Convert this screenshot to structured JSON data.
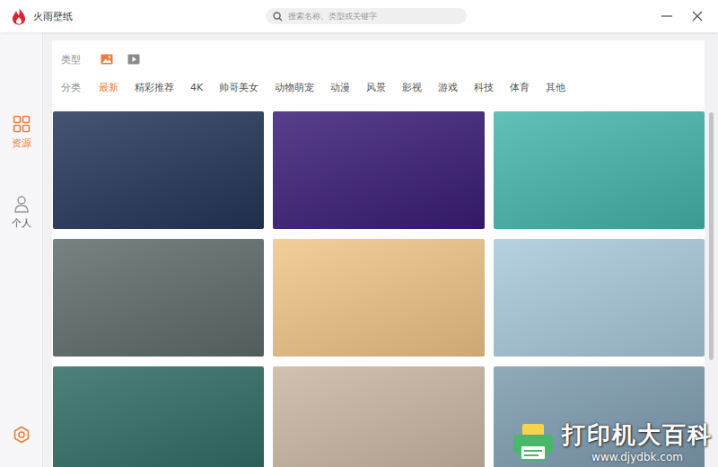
{
  "window": {
    "title": "火雨壁纸"
  },
  "search": {
    "placeholder": "搜索名称、类型或关键字"
  },
  "sidebar": {
    "items": [
      {
        "label": "资源",
        "kind": "grid",
        "selected": true
      },
      {
        "label": "个人",
        "kind": "user",
        "selected": false
      }
    ]
  },
  "filters": {
    "type_label": "类型",
    "types": [
      {
        "kind": "image",
        "selected": true
      },
      {
        "kind": "video",
        "selected": false
      }
    ],
    "category_label": "分类",
    "categories": [
      {
        "label": "最新",
        "selected": true
      },
      {
        "label": "精彩推荐",
        "selected": false
      },
      {
        "label": "4K",
        "selected": false
      },
      {
        "label": "帅哥美女",
        "selected": false
      },
      {
        "label": "动物萌宠",
        "selected": false
      },
      {
        "label": "动漫",
        "selected": false
      },
      {
        "label": "风景",
        "selected": false
      },
      {
        "label": "影视",
        "selected": false
      },
      {
        "label": "游戏",
        "selected": false
      },
      {
        "label": "科技",
        "selected": false
      },
      {
        "label": "体育",
        "selected": false
      },
      {
        "label": "其他",
        "selected": false
      }
    ]
  },
  "wallpapers": [
    {
      "color": "#24365a"
    },
    {
      "color": "#3b1d78"
    },
    {
      "color": "#45b6ae"
    },
    {
      "color": "#5f6d6c"
    },
    {
      "color": "#f0c58a"
    },
    {
      "color": "#a9c9dc"
    },
    {
      "color": "#2f6b62"
    },
    {
      "color": "#c8b7a2"
    },
    {
      "color": "#7c9bb0"
    }
  ],
  "watermark": {
    "title": "打印机大百科",
    "url": "www.djydbk.com"
  }
}
